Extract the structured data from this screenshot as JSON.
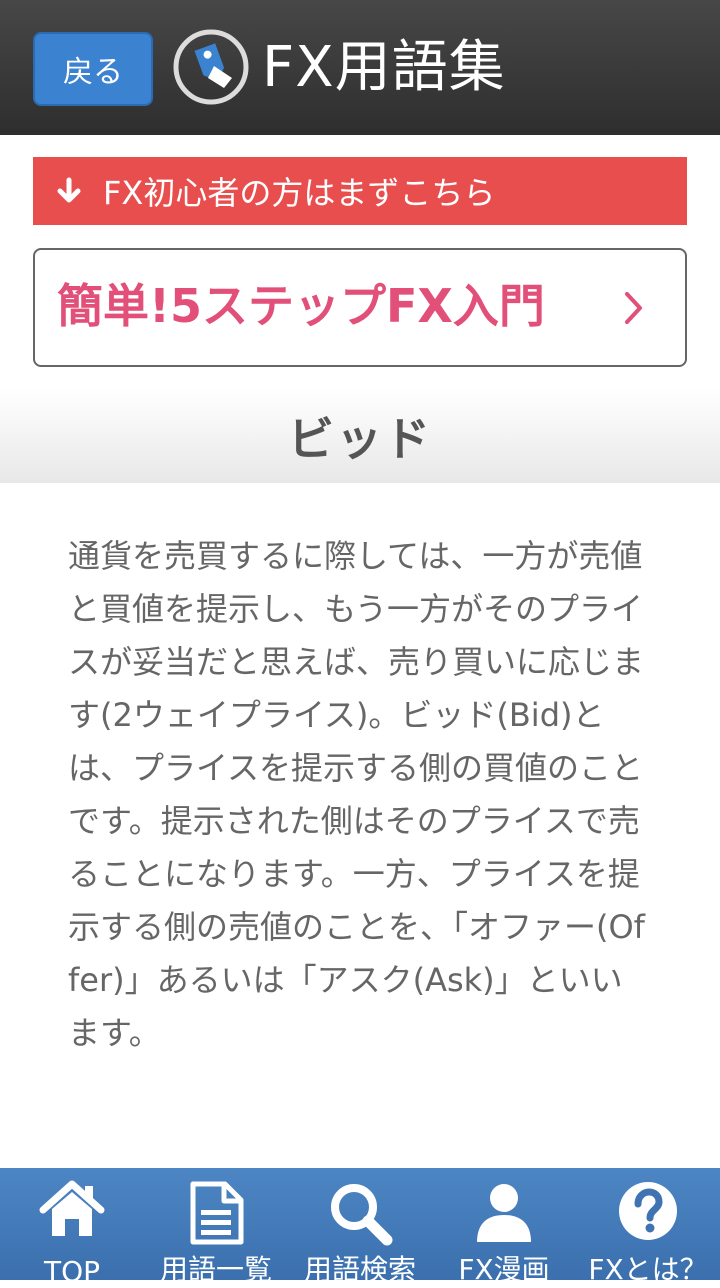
{
  "header": {
    "back_label": "戻る",
    "title": "FX用語集",
    "logo_icon": "tag-icon"
  },
  "beginner_banner": {
    "label": "FX初心者の方はまずこちら",
    "icon": "arrow-down-icon"
  },
  "intro_link": {
    "label": "簡単!5ステップFX入門",
    "icon": "chevron-right-icon"
  },
  "term": {
    "title": "ビッド",
    "description": "通貨を売買するに際しては、一方が売値と買値を提示し、もう一方がそのプライスが妥当だと思えば、売り買いに応じます(2ウェイプライス)。ビッド(Bid)とは、プライスを提示する側の買値のことです。提示された側はそのプライスで売ることになります。一方、プライスを提示する側の売値のことを、「オファー(Offer)」あるいは「アスク(Ask)」といいます。"
  },
  "nav": {
    "items": [
      {
        "label": "TOP",
        "icon": "home-icon"
      },
      {
        "label": "用語一覧",
        "icon": "document-icon"
      },
      {
        "label": "用語検索",
        "icon": "search-icon"
      },
      {
        "label": "FX漫画",
        "icon": "person-icon"
      },
      {
        "label": "FXとは？",
        "icon": "question-icon"
      }
    ]
  },
  "colors": {
    "header_bg": "#3a3a3a",
    "back_button": "#3b83d0",
    "banner_red": "#e94e4e",
    "intro_pink": "#e24f78",
    "nav_blue": "#4479b9"
  }
}
